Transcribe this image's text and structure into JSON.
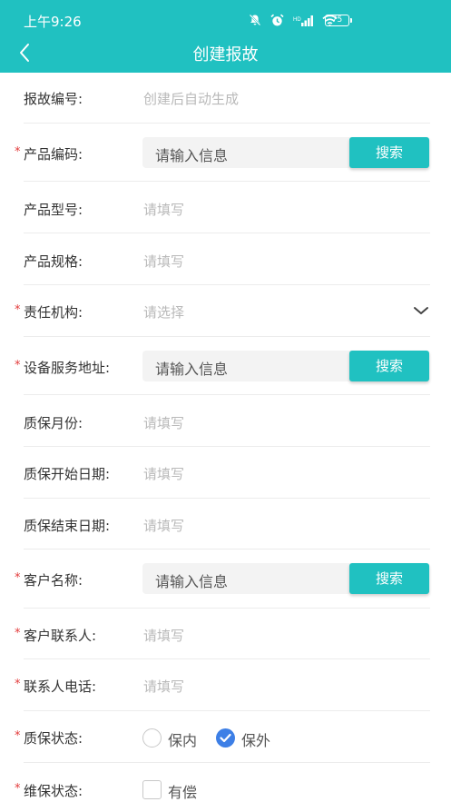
{
  "status_bar": {
    "time": "上午9:26",
    "battery": "75"
  },
  "nav": {
    "title": "创建报故"
  },
  "buttons": {
    "search": "搜索"
  },
  "fields": {
    "report_no": {
      "label": "报故编号:",
      "value": "创建后自动生成"
    },
    "product_code": {
      "label": "产品编码:",
      "placeholder": "请输入信息",
      "required": true
    },
    "product_model": {
      "label": "产品型号:",
      "placeholder": "请填写"
    },
    "product_spec": {
      "label": "产品规格:",
      "placeholder": "请填写"
    },
    "responsible_org": {
      "label": "责任机构:",
      "placeholder": "请选择",
      "required": true
    },
    "device_address": {
      "label": "设备服务地址:",
      "placeholder": "请输入信息",
      "required": true
    },
    "warranty_months": {
      "label": "质保月份:",
      "placeholder": "请填写"
    },
    "warranty_start": {
      "label": "质保开始日期:",
      "placeholder": "请填写"
    },
    "warranty_end": {
      "label": "质保结束日期:",
      "placeholder": "请填写"
    },
    "customer_name": {
      "label": "客户名称:",
      "placeholder": "请输入信息",
      "required": true
    },
    "customer_contact": {
      "label": "客户联系人:",
      "placeholder": "请填写",
      "required": true
    },
    "contact_phone": {
      "label": "联系人电话:",
      "placeholder": "请填写",
      "required": true
    },
    "warranty_status": {
      "label": "质保状态:",
      "required": true,
      "options": [
        {
          "label": "保内",
          "selected": false
        },
        {
          "label": "保外",
          "selected": true
        }
      ]
    },
    "maintenance_status": {
      "label": "维保状态:",
      "required": true,
      "option": {
        "label": "有偿",
        "checked": false
      }
    }
  },
  "colors": {
    "accent": "#20c1c1",
    "required_star": "#e23b3b",
    "radio_selected": "#3d7fe6"
  },
  "icons": [
    "back-arrow-icon",
    "mute-bell-icon",
    "alarm-icon",
    "signal-icon",
    "wifi-icon",
    "battery-icon",
    "chevron-down-icon",
    "check-icon"
  ]
}
